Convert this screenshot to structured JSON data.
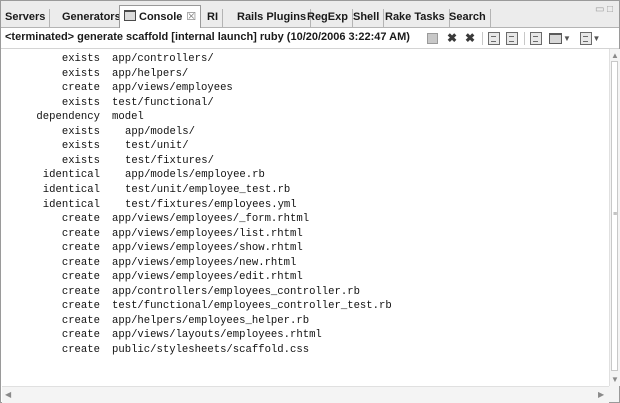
{
  "tabs": [
    {
      "label": "Servers"
    },
    {
      "label": "Generators"
    },
    {
      "label": "Console",
      "close": "☒"
    },
    {
      "label": "RI"
    },
    {
      "label": "Rails Plugins"
    },
    {
      "label": "RegExp"
    },
    {
      "label": "Shell"
    },
    {
      "label": "Rake Tasks"
    },
    {
      "label": "Search"
    }
  ],
  "window_controls": {
    "minimize": "▭",
    "maximize": "□"
  },
  "status_line": "<terminated> generate scaffold [internal launch] ruby (10/20/2006 3:22:47 AM)",
  "toolbar_icons": [
    "terminate-icon",
    "remove-launch-icon",
    "remove-all-terminated-icon",
    "clear-console-icon",
    "scroll-lock-icon",
    "pin-console-icon",
    "display-selected-console-icon",
    "open-console-icon"
  ],
  "console_lines": [
    {
      "verb": "exists",
      "path": "app/controllers/",
      "indent": 0
    },
    {
      "verb": "exists",
      "path": "app/helpers/",
      "indent": 0
    },
    {
      "verb": "create",
      "path": "app/views/employees",
      "indent": 0
    },
    {
      "verb": "exists",
      "path": "test/functional/",
      "indent": 0
    },
    {
      "verb": "dependency",
      "path": "model",
      "indent": 0
    },
    {
      "verb": "exists",
      "path": "app/models/",
      "indent": 2
    },
    {
      "verb": "exists",
      "path": "test/unit/",
      "indent": 2
    },
    {
      "verb": "exists",
      "path": "test/fixtures/",
      "indent": 2
    },
    {
      "verb": "identical",
      "path": "app/models/employee.rb",
      "indent": 2
    },
    {
      "verb": "identical",
      "path": "test/unit/employee_test.rb",
      "indent": 2
    },
    {
      "verb": "identical",
      "path": "test/fixtures/employees.yml",
      "indent": 2
    },
    {
      "verb": "create",
      "path": "app/views/employees/_form.rhtml",
      "indent": 0
    },
    {
      "verb": "create",
      "path": "app/views/employees/list.rhtml",
      "indent": 0
    },
    {
      "verb": "create",
      "path": "app/views/employees/show.rhtml",
      "indent": 0
    },
    {
      "verb": "create",
      "path": "app/views/employees/new.rhtml",
      "indent": 0
    },
    {
      "verb": "create",
      "path": "app/views/employees/edit.rhtml",
      "indent": 0
    },
    {
      "verb": "create",
      "path": "app/controllers/employees_controller.rb",
      "indent": 0
    },
    {
      "verb": "create",
      "path": "test/functional/employees_controller_test.rb",
      "indent": 0
    },
    {
      "verb": "create",
      "path": "app/helpers/employees_helper.rb",
      "indent": 0
    },
    {
      "verb": "create",
      "path": "app/views/layouts/employees.rhtml",
      "indent": 0
    },
    {
      "verb": "create",
      "path": "public/stylesheets/scaffold.css",
      "indent": 0
    }
  ]
}
